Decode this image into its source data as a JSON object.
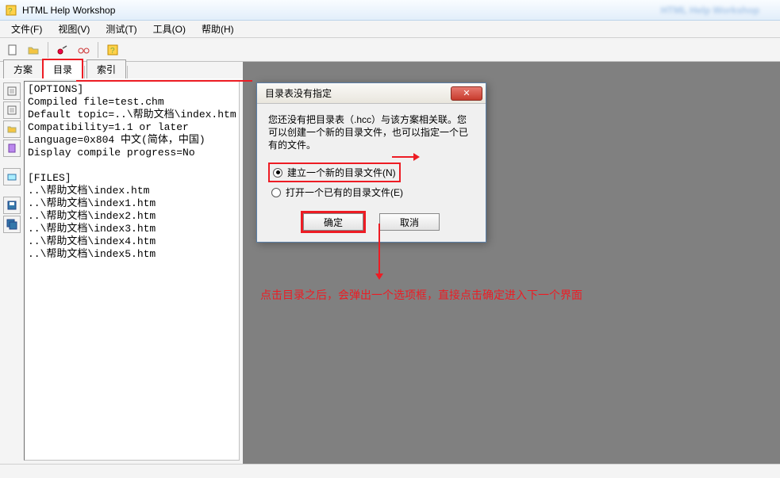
{
  "app": {
    "title": "HTML Help Workshop",
    "blurred_right": "HTML Help Workshop"
  },
  "menu": {
    "file": "文件(F)",
    "view": "视图(V)",
    "test": "测试(T)",
    "tools": "工具(O)",
    "help": "帮助(H)"
  },
  "tabs": {
    "plan": "方案",
    "contents": "目录",
    "index": "索引"
  },
  "options": {
    "header": "[OPTIONS]",
    "lines": [
      "Compiled file=test.chm",
      "Default topic=..\\帮助文档\\index.htm",
      "Compatibility=1.1 or later",
      "Language=0x804 中文(简体，中国)",
      "Display compile progress=No"
    ]
  },
  "files": {
    "header": "[FILES]",
    "lines": [
      "..\\帮助文档\\index.htm",
      "..\\帮助文档\\index1.htm",
      "..\\帮助文档\\index2.htm",
      "..\\帮助文档\\index3.htm",
      "..\\帮助文档\\index4.htm",
      "..\\帮助文档\\index5.htm"
    ]
  },
  "dialog": {
    "title": "目录表没有指定",
    "message": "您还没有把目录表（.hcc）与该方案相关联。您可以创建一个新的目录文件，也可以指定一个已有的文件。",
    "opt_new": "建立一个新的目录文件(N)",
    "opt_open": "打开一个已有的目录文件(E)",
    "ok": "确定",
    "cancel": "取消"
  },
  "annotation": {
    "text": "点击目录之后，会弹出一个选项框，直接点击确定进入下一个界面"
  }
}
